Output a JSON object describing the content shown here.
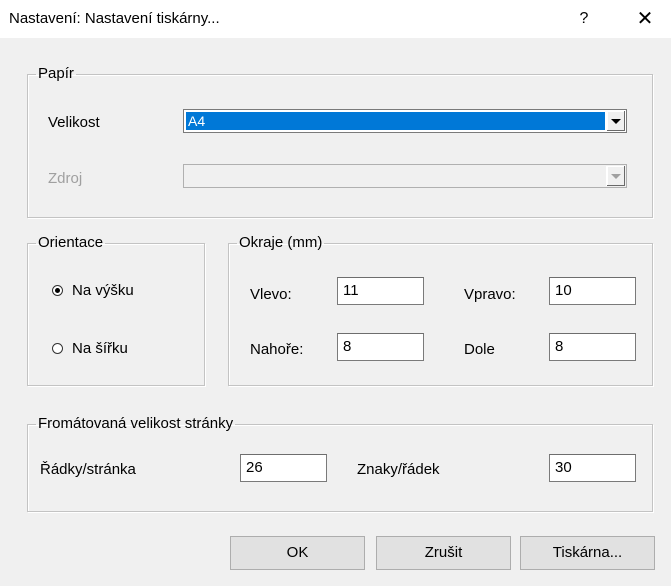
{
  "window": {
    "title": "Nastavení: Nastavení tiskárny...",
    "help_glyph": "?",
    "close_glyph": "✕"
  },
  "paper": {
    "legend": "Papír",
    "size_label": "Velikost",
    "size_value": "A4",
    "source_label": "Zdroj",
    "source_value": ""
  },
  "orientation": {
    "legend": "Orientace",
    "portrait_label": "Na výšku",
    "landscape_label": "Na šířku",
    "selected": "portrait"
  },
  "margins": {
    "legend": "Okraje (mm)",
    "left_label": "Vlevo:",
    "left_value": "11",
    "right_label": "Vpravo:",
    "right_value": "10",
    "top_label": "Nahoře:",
    "top_value": "8",
    "bottom_label": "Dole",
    "bottom_value": "8"
  },
  "formatted": {
    "legend": "Fromátovaná velikost stránky",
    "rows_label": "Řádky/stránka",
    "rows_value": "26",
    "chars_label": "Znaky/řádek",
    "chars_value": "30"
  },
  "buttons": {
    "ok": "OK",
    "cancel": "Zrušit",
    "printer": "Tiskárna..."
  },
  "colors": {
    "accent": "#0078d7",
    "dialog_bg": "#f0f0f0"
  }
}
